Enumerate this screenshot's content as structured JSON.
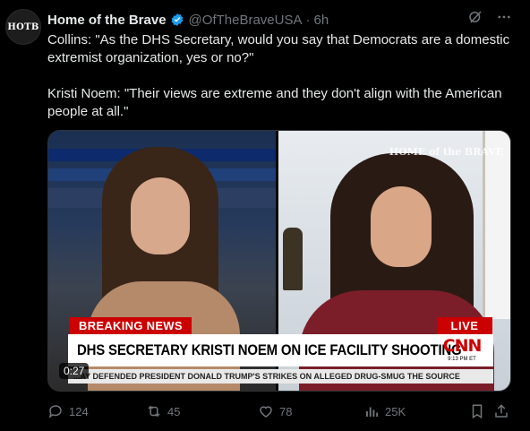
{
  "author": {
    "avatar_text": "HOTB",
    "name": "Home of the Brave",
    "handle": "@OfTheBraveUSA",
    "separator": "·",
    "time": "6h"
  },
  "tweet": {
    "paragraph_1": "Collins: \"As the DHS Secretary, would you say that Democrats are a domestic extremist organization, yes or no?\"",
    "paragraph_2": "Kristi Noem: \"Their views are extreme and they don't align with the American people at all.\""
  },
  "media": {
    "watermark": "HOME of the BRAVE",
    "breaking_label": "BREAKING NEWS",
    "live_label": "LIVE",
    "headline": "DHS SECRETARY KRISTI NOEM ON ICE FACILITY SHOOTING",
    "network_logo": "CNN",
    "network_time": "9:13 PM ET",
    "ticker": "...AY DEFENDED PRESIDENT DONALD TRUMP'S STRIKES ON ALLEGED DRUG-SMUG  THE SOURCE",
    "duration": "0:27"
  },
  "actions": {
    "replies": "124",
    "reposts": "45",
    "likes": "78",
    "views": "25K"
  },
  "colors": {
    "background": "#000000",
    "text": "#e7e9ea",
    "muted": "#71767b",
    "verified": "#1d9bf0",
    "breaking_red": "#cc0000"
  },
  "icons": [
    "verified-badge-icon",
    "grok-icon",
    "more-icon",
    "reply-icon",
    "repost-icon",
    "like-icon",
    "views-icon",
    "bookmark-icon",
    "share-icon"
  ]
}
